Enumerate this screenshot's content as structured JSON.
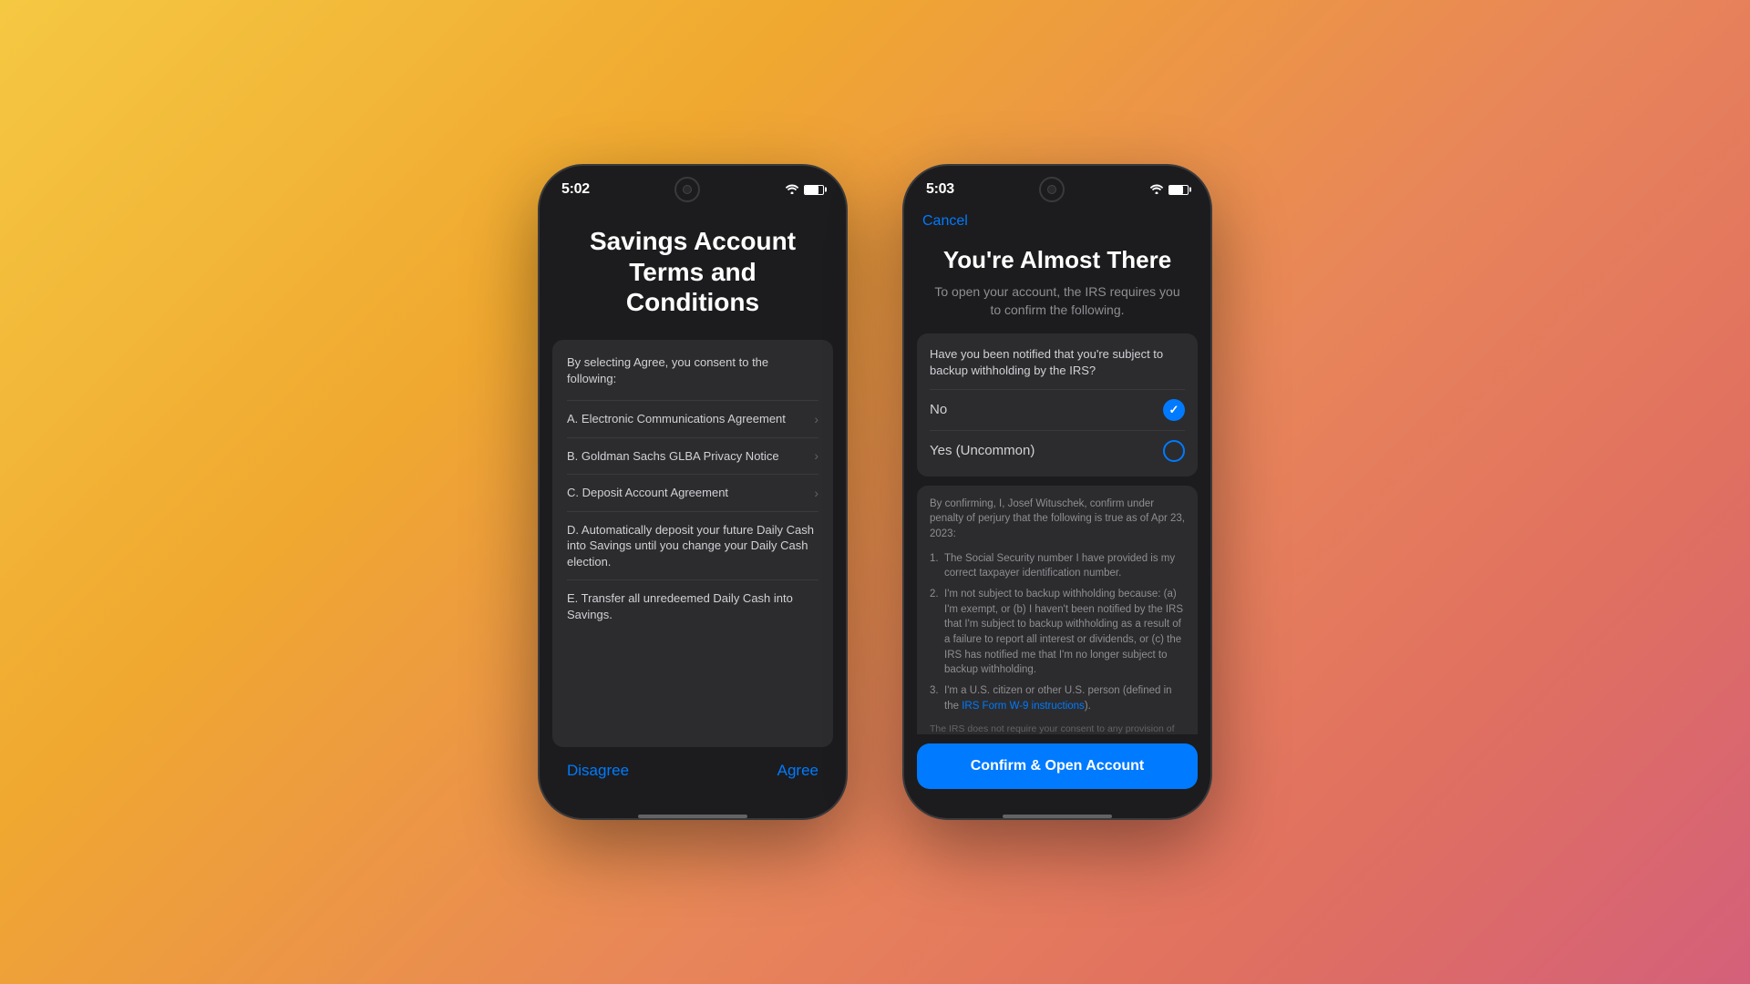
{
  "phone1": {
    "status_bar": {
      "time": "5:02",
      "wifi": "wifi",
      "battery": "battery"
    },
    "title": "Savings Account Terms and Conditions",
    "intro": "By selecting Agree, you consent to the following:",
    "items": [
      {
        "label": "A. Electronic Communications Agreement",
        "has_chevron": true
      },
      {
        "label": "B. Goldman Sachs GLBA Privacy Notice",
        "has_chevron": true
      },
      {
        "label": "C. Deposit Account Agreement",
        "has_chevron": true
      },
      {
        "label": "D. Automatically deposit your future Daily Cash into Savings until you change your Daily Cash election.",
        "has_chevron": false
      },
      {
        "label": "E. Transfer all unredeemed Daily Cash into Savings.",
        "has_chevron": false
      }
    ],
    "footer": {
      "disagree": "Disagree",
      "agree": "Agree"
    }
  },
  "phone2": {
    "status_bar": {
      "time": "5:03",
      "wifi": "wifi",
      "battery": "battery"
    },
    "cancel_label": "Cancel",
    "title": "You're Almost There",
    "subtitle": "To open your account, the IRS requires you to confirm the following.",
    "question": "Have you been notified that you're subject to backup withholding by the IRS?",
    "options": [
      {
        "label": "No",
        "selected": true
      },
      {
        "label": "Yes (Uncommon)",
        "selected": false
      }
    ],
    "confirmation": {
      "intro": "By confirming, I, Josef Wituschek, confirm under penalty of perjury that the following is true as of Apr 23, 2023:",
      "items": [
        "The Social Security number I have provided is my correct taxpayer identification number.",
        "I'm not subject to backup withholding because: (a) I'm exempt, or (b) I haven't been notified by the IRS that I'm subject to backup withholding as a result of a failure to report all interest or dividends, or (c) the IRS has notified me that I'm no longer subject to backup withholding.",
        "I'm a U.S. citizen or other U.S. person (defined in the IRS Form W-9 instructions)."
      ],
      "irs_link_text": "IRS Form W-9 instructions",
      "disclaimer": "The IRS does not require your consent to any provision of this document other than the certifications required to avoid backup withholding."
    },
    "confirm_button": "Confirm & Open Account"
  },
  "icons": {
    "chevron": "›",
    "check": "✓"
  }
}
